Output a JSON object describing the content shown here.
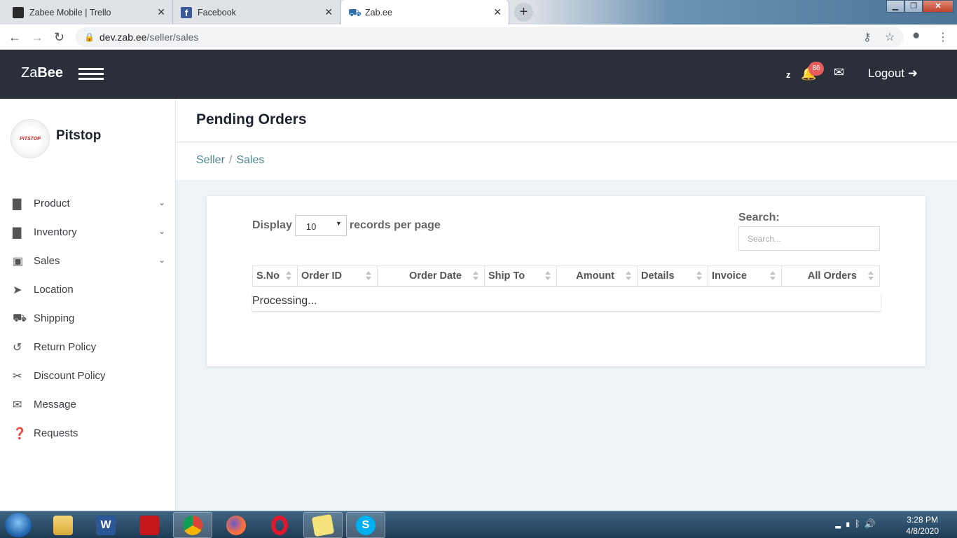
{
  "browser": {
    "tabs": [
      {
        "title": "Zabee Mobile | Trello",
        "favicon_color": "#2a2a2a"
      },
      {
        "title": "Facebook",
        "favicon_color": "#3b5998"
      },
      {
        "title": "Zab.ee",
        "favicon_color": "#2f6fb1"
      }
    ],
    "url_host": "dev.zab.ee",
    "url_path": "/seller/sales"
  },
  "header": {
    "logo_light": "Za",
    "logo_bold": "Bee",
    "user_initial": "z",
    "notification_count": "86",
    "logout_label": "Logout"
  },
  "sidebar": {
    "store_name": "Pitstop",
    "avatar_text": "PITSTOP",
    "items": [
      {
        "label": "Product",
        "icon": "briefcase-icon",
        "expandable": true
      },
      {
        "label": "Inventory",
        "icon": "briefcase-icon",
        "expandable": true
      },
      {
        "label": "Sales",
        "icon": "money-icon",
        "expandable": true
      },
      {
        "label": "Location",
        "icon": "location-arrow-icon",
        "expandable": false
      },
      {
        "label": "Shipping",
        "icon": "truck-icon",
        "expandable": false
      },
      {
        "label": "Return Policy",
        "icon": "undo-icon",
        "expandable": false
      },
      {
        "label": "Discount Policy",
        "icon": "scissors-icon",
        "expandable": false
      },
      {
        "label": "Message",
        "icon": "envelope-icon",
        "expandable": false
      },
      {
        "label": "Requests",
        "icon": "question-circle-icon",
        "expandable": false
      }
    ]
  },
  "page": {
    "title": "Pending Orders",
    "breadcrumb": [
      "Seller",
      "Sales"
    ],
    "display_label": "Display",
    "records_label": "records per page",
    "page_size": "10",
    "search_label": "Search:",
    "search_placeholder": "Search...",
    "columns": [
      "S.No",
      "Order ID",
      "Order Date",
      "Ship To",
      "Amount",
      "Details",
      "Invoice",
      "All Orders"
    ],
    "status_text": "Processing..."
  },
  "taskbar": {
    "apps": [
      "explorer",
      "word",
      "acrobat",
      "chrome",
      "firefox",
      "opera",
      "sticky-notes",
      "skype"
    ],
    "time": "3:28 PM",
    "date": "4/8/2020"
  },
  "colors": {
    "header_bg": "#2b2f39",
    "accent_link": "#4f8a8f",
    "badge": "#e85d5d"
  }
}
